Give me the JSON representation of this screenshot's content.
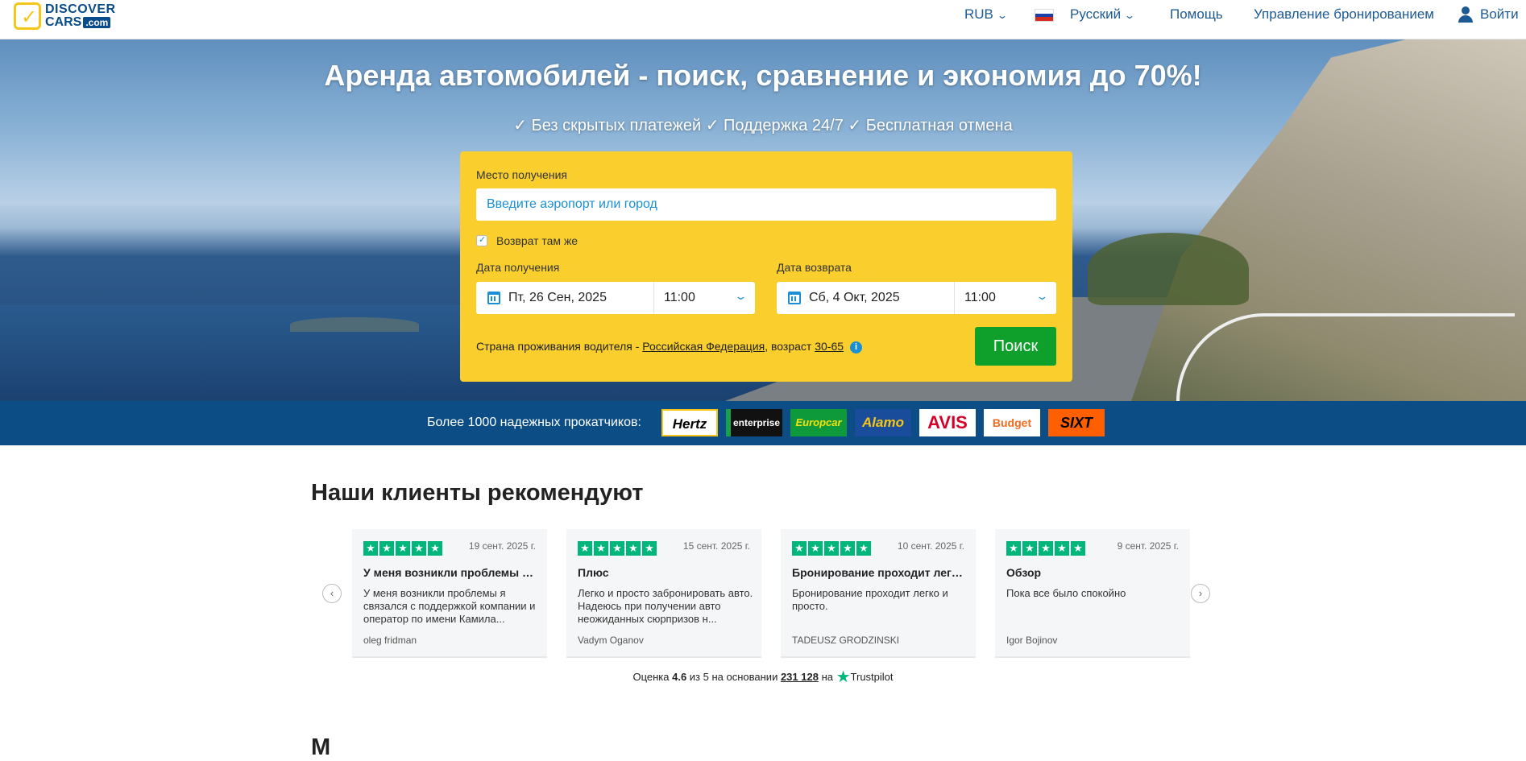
{
  "header": {
    "logo_top": "DISCOVER",
    "logo_bottom": "CARS",
    "logo_com": ".com",
    "currency": "RUB",
    "language": "Русский",
    "help": "Помощь",
    "manage": "Управление бронированием",
    "login": "Войти"
  },
  "hero": {
    "title": "Аренда автомобилей - поиск, сравнение и экономия до 70%!",
    "subtitle": "✓ Без скрытых платежей ✓ Поддержка 24/7 ✓ Бесплатная отмена"
  },
  "search": {
    "place_label": "Место получения",
    "place_placeholder": "Введите аэропорт или город",
    "same_return_label": "Возврат там же",
    "same_return_checked": true,
    "pickup_label": "Дата получения",
    "pickup_date": "Пт, 26 Сен, 2025",
    "pickup_time": "11:00",
    "return_label": "Дата возврата",
    "return_date": "Сб, 4 Окт, 2025",
    "return_time": "11:00",
    "residency_prefix": "Страна проживания водителя - ",
    "residency_country": "Российская Федерация",
    "age_prefix": ", возраст ",
    "age_range": "30-65",
    "button": "Поиск"
  },
  "partners": {
    "label": "Более 1000 надежных прокатчиков:",
    "logos": [
      "Hertz",
      "enterprise",
      "Europcar",
      "Alamo",
      "AVIS",
      "Budget",
      "SIXT"
    ]
  },
  "reviews": {
    "title": "Наши клиенты рекомендуют",
    "items": [
      {
        "date": "19 сент. 2025 г.",
        "title": "У меня возникли проблемы я ...",
        "body": "У меня возникли проблемы я связался с поддержкой компании и оператор по имени Камила...",
        "author": "oleg fridman",
        "stars": 5
      },
      {
        "date": "15 сент. 2025 г.",
        "title": "Плюс",
        "body": "Легко и просто забронировать авто. Надеюсь при получении авто неожиданных сюрпризов н...",
        "author": "Vadym Oganov",
        "stars": 5
      },
      {
        "date": "10 сент. 2025 г.",
        "title": "Бронирование проходит легко...",
        "body": "Бронирование проходит легко и просто.",
        "author": "TADEUSZ GRODZINSKI",
        "stars": 5
      },
      {
        "date": "9 сент. 2025 г.",
        "title": "Обзор",
        "body": "Пока все было спокойно",
        "author": "Igor Bojinov",
        "stars": 5
      }
    ],
    "rating_prefix": "Оценка ",
    "rating_value": "4.6",
    "rating_mid": " из 5 на основании ",
    "rating_count": "231 128",
    "rating_on": " на ",
    "trustpilot": "Trustpilot"
  },
  "next_section_title": "М"
}
